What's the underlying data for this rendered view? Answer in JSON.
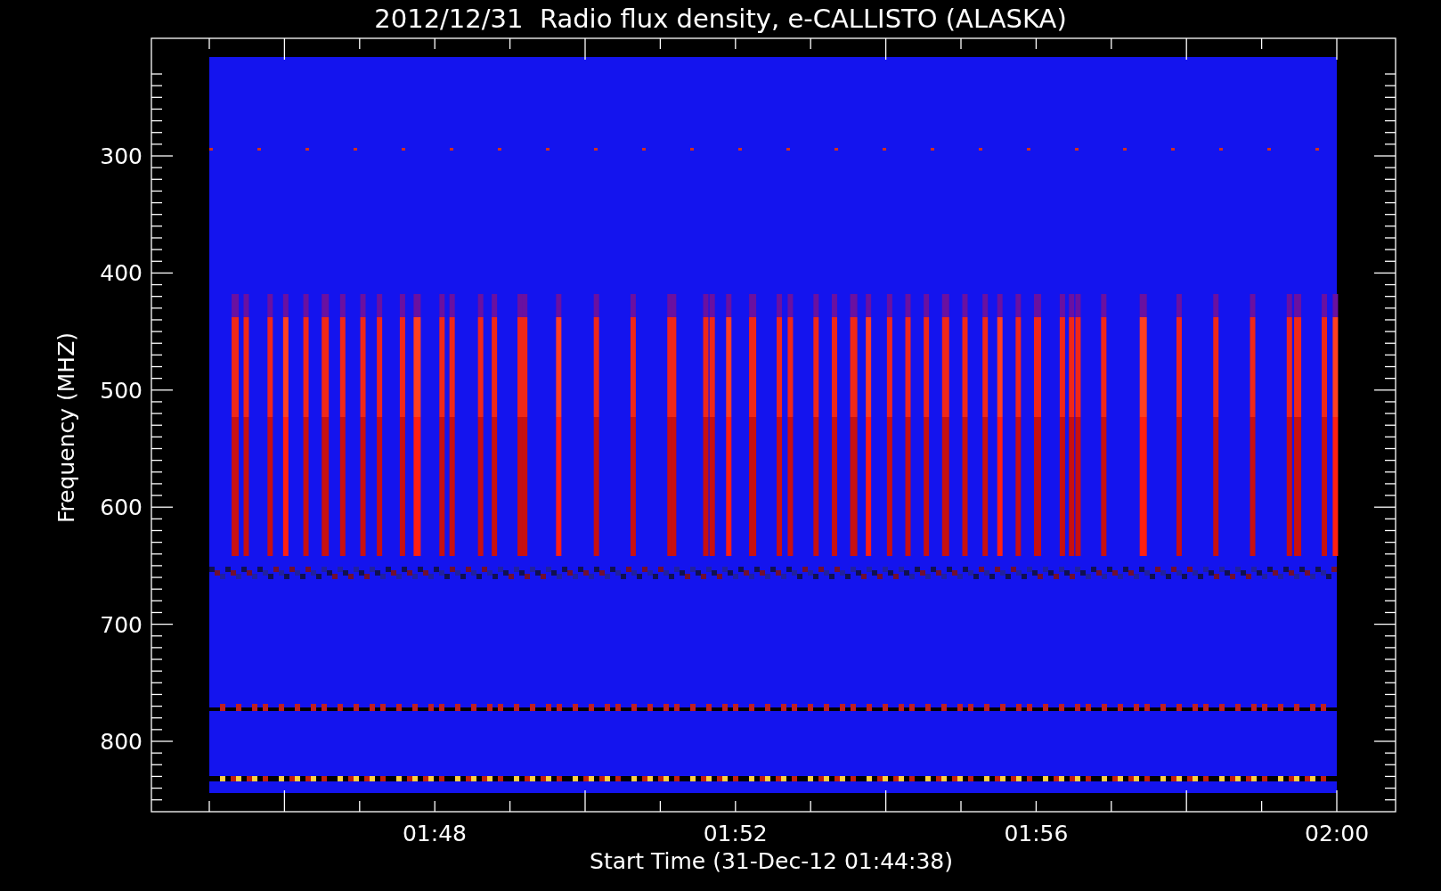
{
  "plot": {
    "title": "2012/12/31  Radio flux density, e-CALLISTO (ALASKA)",
    "ylabel": "Frequency (MHZ)",
    "xlabel": "Start Time (31-Dec-12 01:44:38)",
    "y_tick_labels": [
      "300",
      "400",
      "500",
      "600",
      "700",
      "800"
    ],
    "x_tick_labels": [
      "01:48",
      "01:52",
      "01:56",
      "02:00"
    ]
  }
}
